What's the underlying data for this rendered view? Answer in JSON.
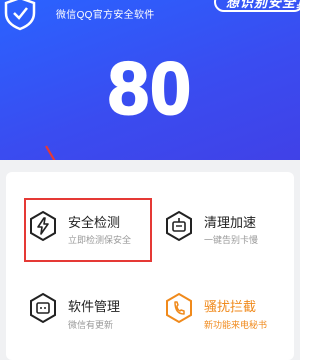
{
  "header": {
    "tagline": "微信QQ官方安全软件",
    "cert_badge": "想识别安全真实安全",
    "logo_icon": "shield-check-icon"
  },
  "score": {
    "value": "80"
  },
  "tiles": [
    {
      "title": "安全检测",
      "subtitle": "立即检测保安全",
      "icon": "bolt-hexagon-icon",
      "highlighted": true
    },
    {
      "title": "清理加速",
      "subtitle": "一键告别卡慢",
      "icon": "broom-cleanup-icon"
    },
    {
      "title": "软件管理",
      "subtitle": "微信有更新",
      "icon": "app-box-icon"
    },
    {
      "title": "骚扰拦截",
      "subtitle": "新功能来电秘书",
      "icon": "phone-block-icon",
      "accent": "#f08a1c"
    }
  ],
  "colors": {
    "hero_start": "#2a63ff",
    "hero_end": "#4140e6",
    "highlight": "#e53935",
    "accent_orange": "#f08a1c"
  }
}
